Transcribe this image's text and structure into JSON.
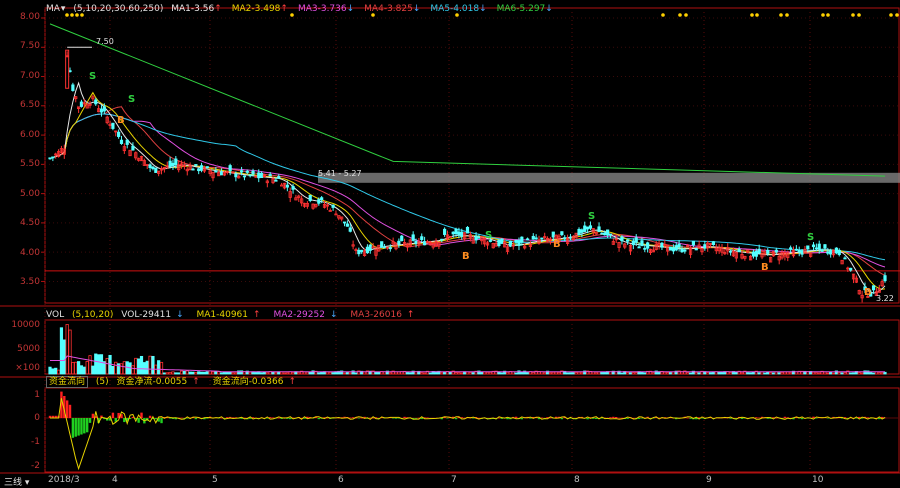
{
  "price_panel": {
    "indicator": "MA",
    "params": "(5,10,20,30,60,250)",
    "items": [
      {
        "label": "MA1",
        "value": "3.56",
        "arrow": "↑",
        "color": "#e8e8e8"
      },
      {
        "label": "MA2",
        "value": "3.498",
        "arrow": "↑",
        "color": "#e8d400"
      },
      {
        "label": "MA3",
        "value": "3.736",
        "arrow": "↓",
        "color": "#e050e0"
      },
      {
        "label": "MA4",
        "value": "3.825",
        "arrow": "↓",
        "color": "#e04040"
      },
      {
        "label": "MA5",
        "value": "4.018",
        "arrow": "↓",
        "color": "#30c8e8"
      },
      {
        "label": "MA6",
        "value": "5.297",
        "arrow": "↓",
        "color": "#30d040"
      }
    ],
    "y_ticks": [
      "8.00",
      "7.50",
      "7.00",
      "6.50",
      "6.00",
      "5.50",
      "5.00",
      "4.50",
      "4.00",
      "3.50"
    ],
    "high_label": "7.50",
    "range_label": "5.41 - 5.27",
    "last_label": "3.22"
  },
  "volume_panel": {
    "indicator": "VOL",
    "params": "(5,10,20)",
    "vol": "VOL-29411",
    "vol_arrow": "↓",
    "ma1": "MA1-40961",
    "ma1_arrow": "↑",
    "ma2": "MA2-29252",
    "ma2_arrow": "↓",
    "ma3": "MA3-26016",
    "ma3_arrow": "↑",
    "y_ticks": [
      "10000",
      "5000",
      "×100"
    ]
  },
  "flow_panel": {
    "indicator": "资金流向",
    "params": "(5)",
    "item1": "资金净流-0.0055",
    "item1_arrow": "↑",
    "item2": "资金流向-0.0366",
    "item2_arrow": "↑",
    "y_ticks": [
      "1",
      "0",
      "-1",
      "-2"
    ]
  },
  "x_axis": {
    "menu": "三线",
    "labels": [
      "2018/3",
      "4",
      "5",
      "6",
      "7",
      "8",
      "9",
      "10"
    ]
  },
  "signals": {
    "buy": "B",
    "sell": "S"
  },
  "colors": {
    "up": "#ff3232",
    "down": "#54ffff",
    "axis": "#b01010",
    "ma250": "#30d040"
  },
  "chart_data": {
    "type": "candlestick",
    "ylim": [
      3.2,
      8.0
    ],
    "price_path": [
      [
        0,
        5.6
      ],
      [
        3,
        5.7
      ],
      [
        5,
        5.8
      ],
      [
        6,
        7.4
      ],
      [
        8,
        6.8
      ],
      [
        10,
        6.5
      ],
      [
        15,
        6.6
      ],
      [
        20,
        6.3
      ],
      [
        25,
        5.9
      ],
      [
        30,
        5.7
      ],
      [
        36,
        5.4
      ],
      [
        45,
        5.5
      ],
      [
        55,
        5.4
      ],
      [
        62,
        5.35
      ],
      [
        70,
        5.3
      ],
      [
        80,
        5.25
      ],
      [
        88,
        4.9
      ],
      [
        95,
        4.85
      ],
      [
        100,
        4.7
      ],
      [
        104,
        4.45
      ],
      [
        107,
        4.0
      ],
      [
        115,
        4.1
      ],
      [
        125,
        4.15
      ],
      [
        135,
        4.2
      ],
      [
        140,
        4.3
      ],
      [
        150,
        4.25
      ],
      [
        160,
        4.1
      ],
      [
        170,
        4.2
      ],
      [
        180,
        4.25
      ],
      [
        190,
        4.4
      ],
      [
        200,
        4.15
      ],
      [
        210,
        4.1
      ],
      [
        220,
        4.05
      ],
      [
        230,
        4.1
      ],
      [
        240,
        4.0
      ],
      [
        250,
        3.95
      ],
      [
        260,
        4.0
      ],
      [
        270,
        4.05
      ],
      [
        276,
        4.0
      ],
      [
        281,
        3.6
      ],
      [
        284,
        3.3
      ],
      [
        288,
        3.3
      ],
      [
        292,
        3.55
      ]
    ],
    "ma250": [
      [
        0,
        7.9
      ],
      [
        120,
        5.55
      ],
      [
        292,
        5.3
      ]
    ]
  }
}
